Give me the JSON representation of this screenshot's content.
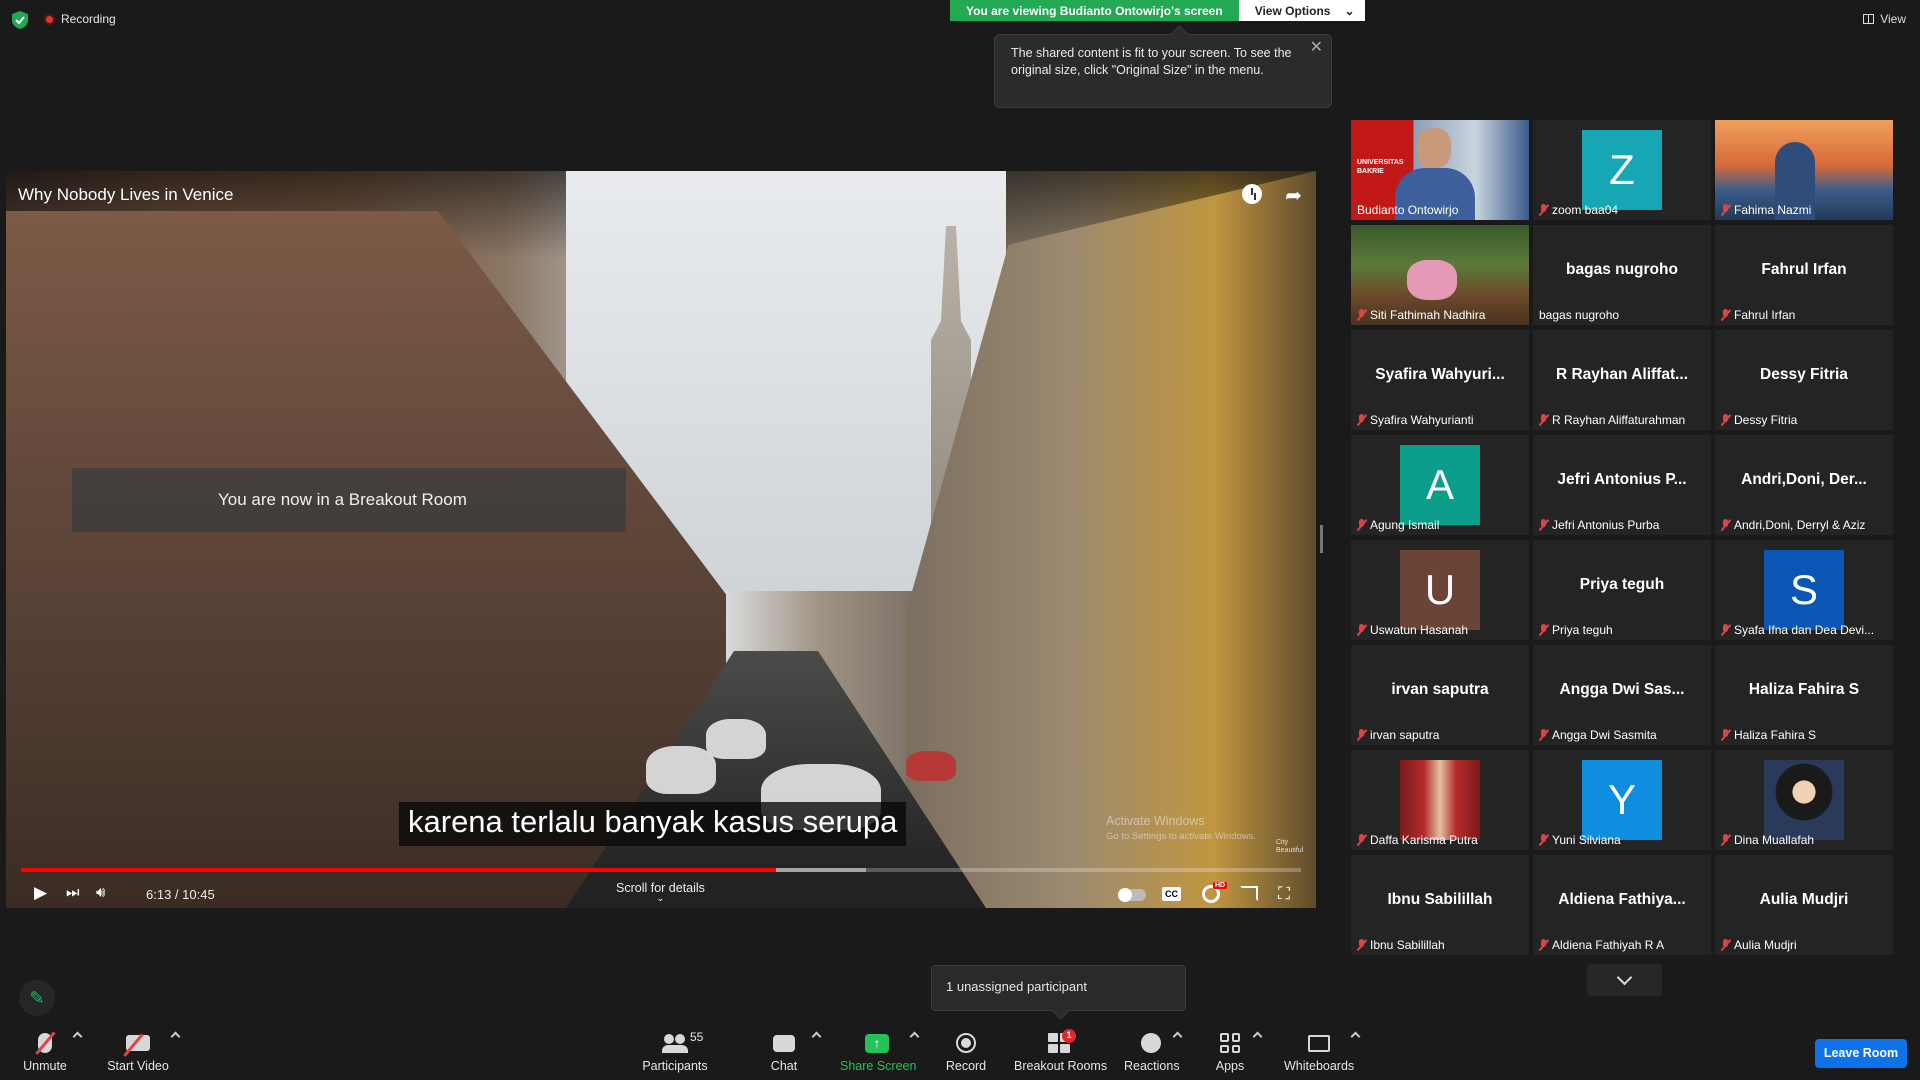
{
  "top": {
    "recording_label": "Recording",
    "viewing_banner": "You are viewing Budianto Ontowirjo's screen",
    "view_options": "View Options",
    "view_label": "View"
  },
  "tooltip": {
    "text": "The shared content is fit to your screen. To see the original size, click \"Original Size\" in the menu."
  },
  "video": {
    "title": "Why Nobody Lives in Venice",
    "breakout_notice": "You are now in a Breakout Room",
    "subtitle": "karena terlalu banyak kasus serupa",
    "time": "6:13 / 10:45",
    "scroll_hint": "Scroll for details",
    "played_fraction": 0.59,
    "buffered_fraction": 0.66,
    "cc_label": "CC",
    "hd_badge": "HD",
    "watermark_title": "Activate Windows",
    "watermark_sub": "Go to Settings to activate Windows.",
    "corner_brand": "City Beautiful"
  },
  "participants": [
    {
      "display": "",
      "label": "Budianto Ontowirjo",
      "muted": false,
      "kind": "video-ub",
      "active": true,
      "photo_caption": "UNIVERSITAS BAKRIE"
    },
    {
      "display": "Z",
      "label": "zoom baa04",
      "muted": true,
      "kind": "avatar",
      "color": "#17a6b3"
    },
    {
      "display": "",
      "label": "Fahima Nazmi",
      "muted": true,
      "kind": "photo-bridge"
    },
    {
      "display": "",
      "label": "Siti Fathimah Nadhira",
      "muted": true,
      "kind": "photo-plant"
    },
    {
      "display": "bagas nugroho",
      "label": "bagas nugroho",
      "muted": false,
      "kind": "name"
    },
    {
      "display": "Fahrul Irfan",
      "label": "Fahrul Irfan",
      "muted": true,
      "kind": "name"
    },
    {
      "display": "Syafira  Wahyuri...",
      "label": "Syafira Wahyurianti",
      "muted": true,
      "kind": "name"
    },
    {
      "display": "R Rayhan Aliffat...",
      "label": "R Rayhan Aliffaturahman",
      "muted": true,
      "kind": "name"
    },
    {
      "display": "Dessy Fitria",
      "label": "Dessy Fitria",
      "muted": true,
      "kind": "name"
    },
    {
      "display": "A",
      "label": "Agung Ismail",
      "muted": true,
      "kind": "avatar",
      "color": "#0c9c8a"
    },
    {
      "display": "Jefri Antonius P...",
      "label": "Jefri Antonius Purba",
      "muted": true,
      "kind": "name"
    },
    {
      "display": "Andri,Doni,  Der...",
      "label": "Andri,Doni, Derryl & Aziz",
      "muted": true,
      "kind": "name"
    },
    {
      "display": "U",
      "label": "Uswatun Hasanah",
      "muted": true,
      "kind": "avatar",
      "color": "#6b4438"
    },
    {
      "display": "Priya teguh",
      "label": "Priya teguh",
      "muted": true,
      "kind": "name"
    },
    {
      "display": "S",
      "label": "Syafa Ifna dan Dea Devi...",
      "muted": true,
      "kind": "avatar",
      "color": "#0a56b5"
    },
    {
      "display": "irvan saputra",
      "label": "irvan saputra",
      "muted": true,
      "kind": "name"
    },
    {
      "display": "Angga Dwi Sas...",
      "label": "Angga Dwi Sasmita",
      "muted": true,
      "kind": "name"
    },
    {
      "display": "Haliza Fahira S",
      "label": "Haliza Fahira S",
      "muted": true,
      "kind": "name"
    },
    {
      "display": "",
      "label": "Daffa Karisma Putra",
      "muted": true,
      "kind": "photo-man"
    },
    {
      "display": "Y",
      "label": "Yuni Silviana",
      "muted": true,
      "kind": "avatar",
      "color": "#0f8ee0"
    },
    {
      "display": "",
      "label": "Dina Muallafah",
      "muted": true,
      "kind": "photo-woman"
    },
    {
      "display": "Ibnu Sabilillah",
      "label": "Ibnu Sabilillah",
      "muted": true,
      "kind": "name"
    },
    {
      "display": "Aldiena  Fathiya...",
      "label": "Aldiena Fathiyah R A",
      "muted": true,
      "kind": "name"
    },
    {
      "display": "Aulia Mudjri",
      "label": "Aulia Mudjri",
      "muted": true,
      "kind": "name"
    }
  ],
  "unassigned": "1 unassigned participant",
  "toolbar": {
    "unmute": "Unmute",
    "start_video": "Start Video",
    "participants": "Participants",
    "participants_count": "55",
    "chat": "Chat",
    "share_screen": "Share Screen",
    "record": "Record",
    "breakout_rooms": "Breakout Rooms",
    "breakout_badge": "1",
    "reactions": "Reactions",
    "apps": "Apps",
    "whiteboards": "Whiteboards",
    "leave": "Leave Room"
  },
  "colors": {
    "accent_green": "#23a853",
    "leave_blue": "#0e72ed",
    "progress_red": "#ff0000",
    "muted_red": "#e04343"
  }
}
